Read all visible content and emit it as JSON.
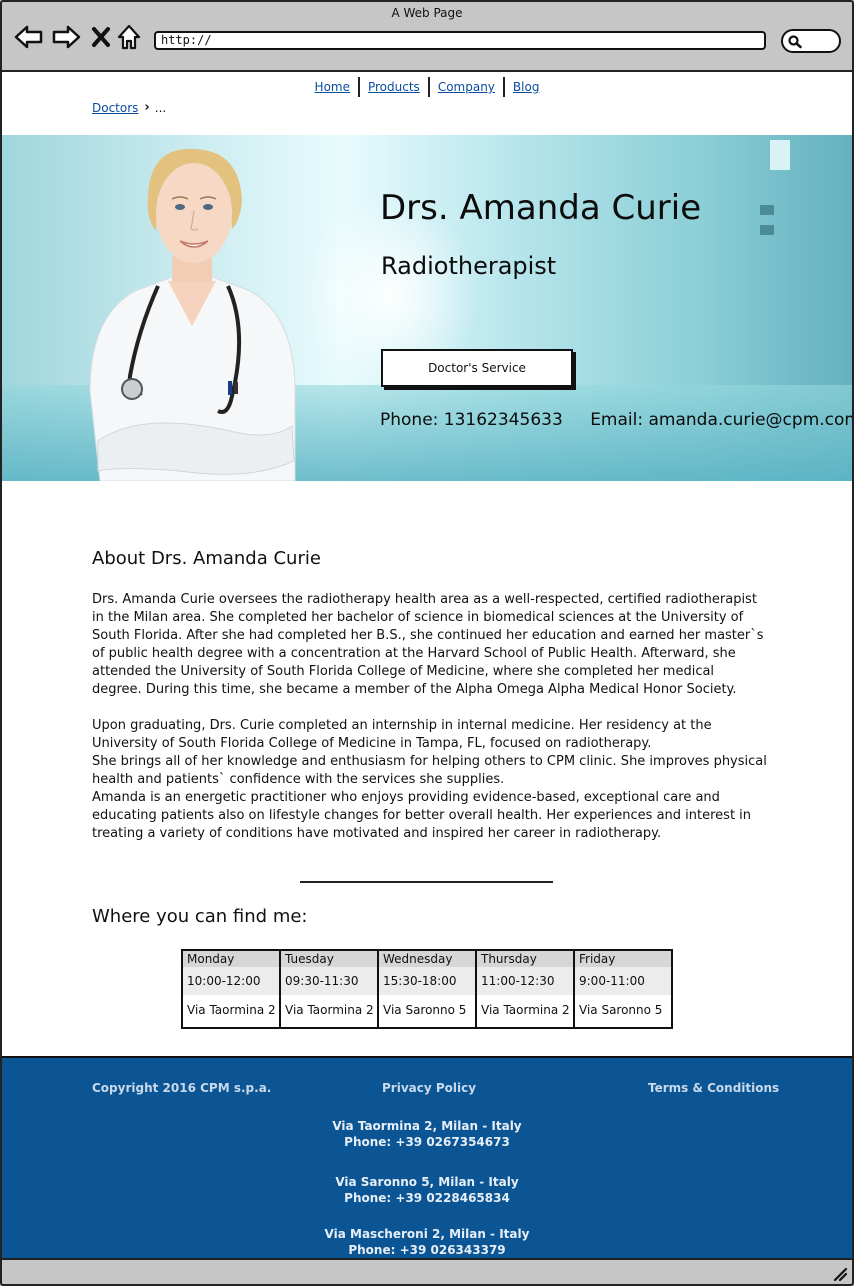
{
  "window": {
    "title": "A Web Page",
    "url": "http://"
  },
  "nav": {
    "items": [
      "Home",
      "Products",
      "Company",
      "Blog"
    ]
  },
  "breadcrumb": {
    "link": "Doctors",
    "ellipsis": "..."
  },
  "hero": {
    "name": "Drs. Amanda Curie",
    "title": "Radiotherapist",
    "service_button": "Doctor's Service",
    "phone": "Phone: 13162345633",
    "email": "Email: amanda.curie@cpm.com"
  },
  "about": {
    "heading": "About Drs. Amanda Curie",
    "paragraph1": "Drs. Amanda Curie oversees the radiotherapy health area as a well-respected, certified radiotherapist in the Milan area. She completed her bachelor of science in biomedical sciences at the University of South Florida. After she had completed her B.S., she continued her education and earned her master`s of public health degree with a concentration at the Harvard School of Public Health. Afterward, she attended the University of South Florida College of Medicine, where she completed her medical degree. During this time, she became a member of the Alpha Omega Alpha Medical Honor Society.",
    "paragraph2": "Upon graduating, Drs. Curie completed an internship in internal medicine. Her residency at the University of South Florida College of Medicine in Tampa, FL, focused on radiotherapy.",
    "paragraph3": "She brings all of her knowledge and enthusiasm for helping others to CPM clinic. She improves physical health and patients` confidence with the services she supplies.",
    "paragraph4": "Amanda is an energetic practitioner who enjoys providing evidence-based, exceptional care and educating patients also on lifestyle changes for better overall health. Her experiences and interest in treating a variety of conditions have motivated and inspired her career in radiotherapy."
  },
  "schedule": {
    "heading": "Where you can find me:",
    "days": [
      {
        "day": "Monday",
        "hours": "10:00-12:00",
        "place": "Via Taormina 2"
      },
      {
        "day": "Tuesday",
        "hours": "09:30-11:30",
        "place": "Via Taormina 2"
      },
      {
        "day": "Wednesday",
        "hours": "15:30-18:00",
        "place": "Via Saronno 5"
      },
      {
        "day": "Thursday",
        "hours": "11:00-12:30",
        "place": "Via Taormina 2"
      },
      {
        "day": "Friday",
        "hours": "9:00-11:00",
        "place": "Via Saronno 5"
      }
    ]
  },
  "footer": {
    "copyright": "Copyright 2016 CPM s.p.a.",
    "privacy": "Privacy Policy",
    "terms": "Terms & Conditions",
    "addresses": [
      {
        "line1": "Via Taormina 2, Milan - Italy",
        "line2": "Phone: +39 0267354673"
      },
      {
        "line1": "Via Saronno 5, Milan - Italy",
        "line2": "Phone: +39 0228465834"
      },
      {
        "line1": "Via Mascheroni 2, Milan - Italy",
        "line2": "Phone: +39 026343379"
      }
    ],
    "color": "#0b5595"
  },
  "icons": [
    "back-arrow-icon",
    "forward-arrow-icon",
    "close-icon",
    "home-icon",
    "search-icon",
    "resize-grip-icon"
  ]
}
